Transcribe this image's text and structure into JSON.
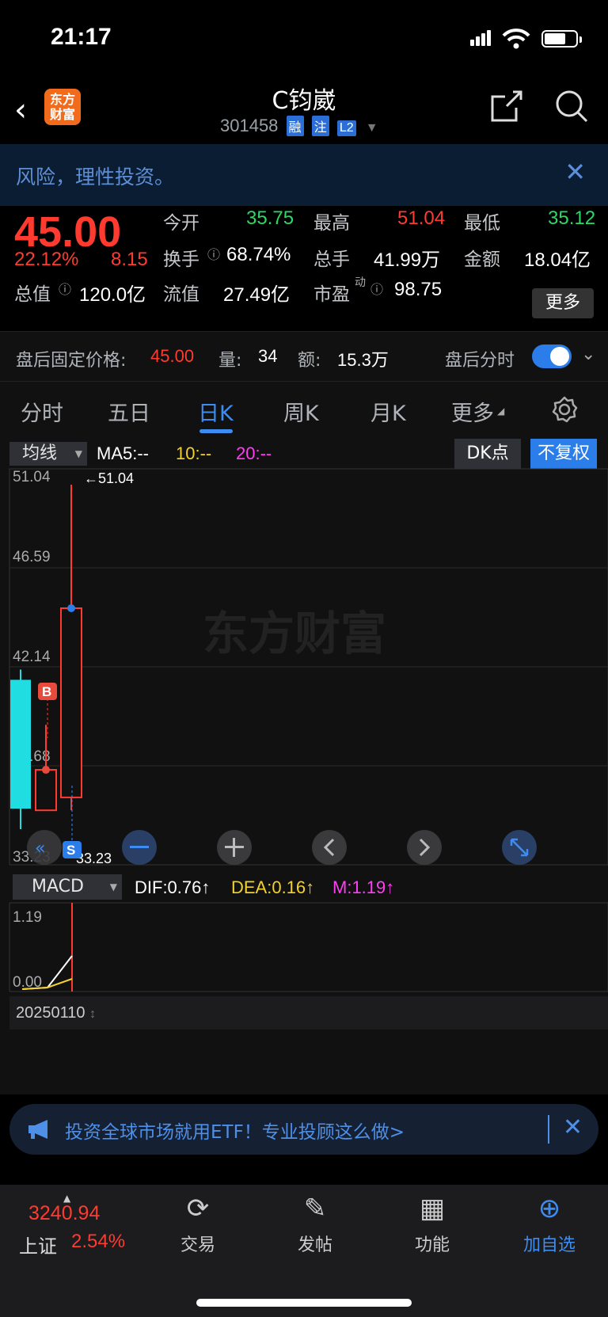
{
  "status_bar": {
    "time": "21:17"
  },
  "header": {
    "back_icon": "chevron-left-icon",
    "logo": "东方财富",
    "logo_line1": "东方",
    "logo_line2": "财富",
    "title": "C钧崴",
    "code": "301458",
    "tags": [
      "融",
      "注",
      "L2"
    ]
  },
  "risk_banner": {
    "text": "风险，理性投资。"
  },
  "quote": {
    "price": "45.00",
    "change_pct": "22.12%",
    "change": "8.15",
    "fields": {
      "open_label": "今开",
      "open": "35.75",
      "high_label": "最高",
      "high": "51.04",
      "low_label": "最低",
      "low": "35.12",
      "turnover_label": "换手",
      "turnover": "68.74%",
      "volume_label": "总手",
      "volume": "41.99万",
      "amount_label": "金额",
      "amount": "18.04亿",
      "mcap_label": "总值",
      "mcap": "120.0亿",
      "float_label": "流值",
      "float": "27.49亿",
      "pe_label": "市盈",
      "pe_sup": "动",
      "pe": "98.75"
    },
    "more_button": "更多"
  },
  "after_hours": {
    "price_label": "盘后固定价格:",
    "price": "45.00",
    "vol_label": "量:",
    "vol": "34",
    "amt_label": "额:",
    "amt": "15.3万",
    "timeshare_label": "盘后分时",
    "toggle_on": true
  },
  "tabs": [
    "分时",
    "五日",
    "日K",
    "周K",
    "月K",
    "更多"
  ],
  "active_tab": "日K",
  "chart": {
    "ma_selector": "均线",
    "ma5": "MA5:--",
    "ma10": "10:--",
    "ma20": "20:--",
    "dk_button": "DK点",
    "adjust_button": "不复权",
    "y_ticks": [
      "51.04",
      "46.59",
      "42.14",
      "37.68",
      "33.23"
    ],
    "high_marker": "←51.04",
    "low_marker": "33.23",
    "watermark": "东方财富",
    "buy_marker": "B",
    "sell_marker": "S",
    "macd_selector": "MACD",
    "dif": "DIF:0.76↑",
    "dea": "DEA:0.16↑",
    "m": "M:1.19↑",
    "macd_ticks": [
      "1.19",
      "0.00"
    ],
    "date": "20250110",
    "colors": {
      "up": "#ff3b30",
      "down": "#1fdde0",
      "dif": "#ffffff",
      "dea": "#f2d12c",
      "m": "#ff3df5"
    }
  },
  "chart_data": {
    "type": "candlestick",
    "ylim": [
      33.23,
      51.04
    ],
    "candles": [
      {
        "open": 41.5,
        "close": 35.2,
        "high": 42.0,
        "low": 34.2,
        "dir": "down"
      },
      {
        "open": 35.12,
        "close": 37.1,
        "high": 39.3,
        "low": 35.12,
        "dir": "up"
      },
      {
        "open": 35.75,
        "close": 45.0,
        "high": 51.04,
        "low": 35.12,
        "dir": "up"
      }
    ]
  },
  "etf_banner": {
    "text": "投资全球市场就用ETF！专业投顾这么做>"
  },
  "bottom_bar": {
    "index_value": "3240.94",
    "index_name": "上证",
    "index_pct": "2.54%",
    "nav": [
      {
        "label": "交易",
        "icon": "yen-cycle-icon"
      },
      {
        "label": "发帖",
        "icon": "edit-icon"
      },
      {
        "label": "功能",
        "icon": "grid-icon"
      },
      {
        "label": "加自选",
        "icon": "add-circle-icon"
      }
    ]
  }
}
